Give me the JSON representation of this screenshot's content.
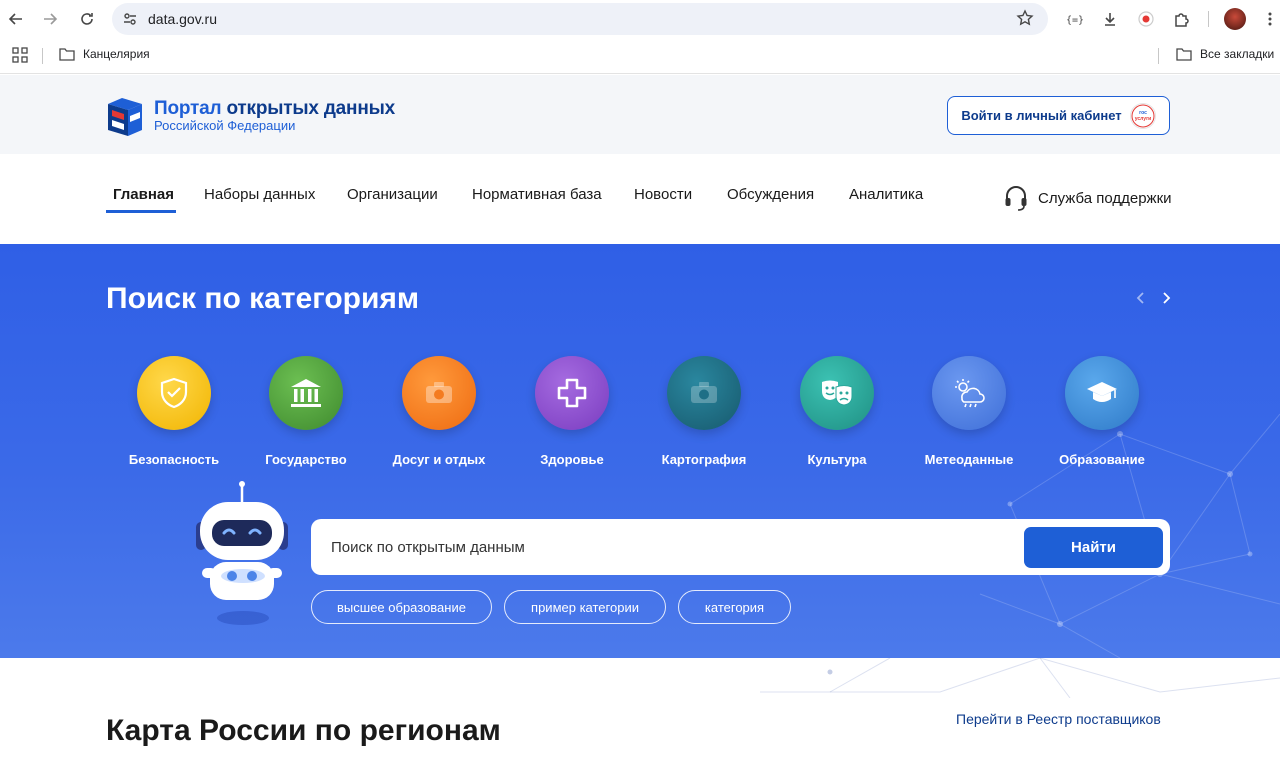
{
  "browser": {
    "url": "data.gov.ru",
    "bookmarks": {
      "folder": "Канцелярия",
      "all_bookmarks": "Все закладки"
    },
    "extensions": [
      "code-icon",
      "download-icon",
      "record-icon",
      "puzzle-icon"
    ]
  },
  "header": {
    "logo_title_part1": "Портал",
    "logo_title_part2": "открытых данных",
    "logo_subtitle": "Российской Федерации",
    "login_label": "Войти в личный кабинет",
    "gosuslugi_text": "гос услуги"
  },
  "nav": {
    "items": [
      {
        "label": "Главная",
        "active": true
      },
      {
        "label": "Наборы данных"
      },
      {
        "label": "Организации"
      },
      {
        "label": "Нормативная база"
      },
      {
        "label": "Новости"
      },
      {
        "label": "Обсуждения"
      },
      {
        "label": "Аналитика"
      }
    ],
    "support_label": "Служба поддержки"
  },
  "hero": {
    "title": "Поиск по категориям",
    "categories": [
      {
        "label": "Безопасность",
        "icon": "shield-icon",
        "color": "#f5c518"
      },
      {
        "label": "Государство",
        "icon": "government-building-icon",
        "color": "#4f9a3c"
      },
      {
        "label": "Досуг и отдых",
        "icon": "camera-icon",
        "color": "#f47b20"
      },
      {
        "label": "Здоровье",
        "icon": "medical-cross-icon",
        "color": "#8b4fc9"
      },
      {
        "label": "Картография",
        "icon": "camera-icon",
        "color": "#1f6f86"
      },
      {
        "label": "Культура",
        "icon": "theatre-masks-icon",
        "color": "#2aa79b"
      },
      {
        "label": "Метеоданные",
        "icon": "weather-icon",
        "color": "#4d7fe0"
      },
      {
        "label": "Образование",
        "icon": "graduation-cap-icon",
        "color": "#3c8fd9"
      }
    ],
    "search": {
      "placeholder": "Поиск по открытым данным",
      "button_label": "Найти"
    },
    "chips": [
      "высшее образование",
      "пример категории",
      "категория"
    ]
  },
  "below": {
    "map_title": "Карта России по регионам",
    "registry_link": "Перейти в Реестр поставщиков"
  },
  "colors": {
    "brand_blue": "#1e5fd6",
    "brand_dark": "#0d3b8c",
    "hero_bg": "#3b6ae8"
  }
}
